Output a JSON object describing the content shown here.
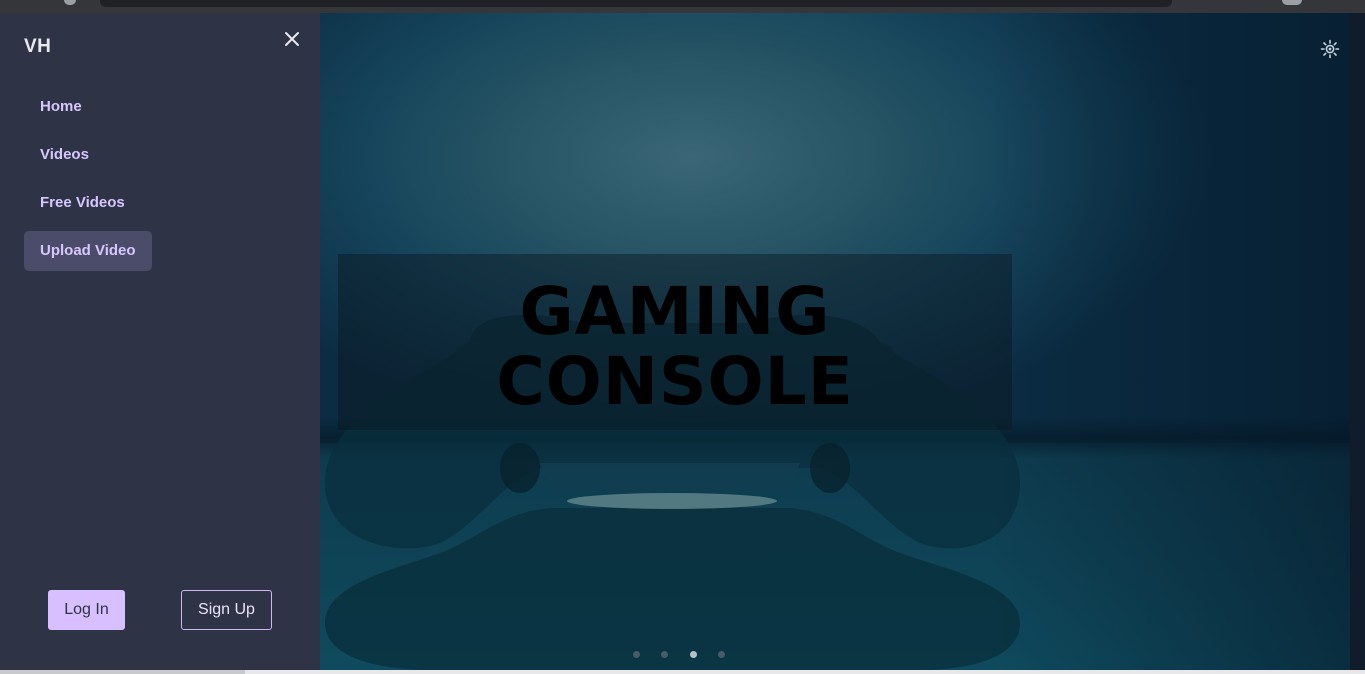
{
  "brand": "VH",
  "nav": {
    "items": [
      {
        "label": "Home"
      },
      {
        "label": "Videos"
      },
      {
        "label": "Free Videos"
      },
      {
        "label": "Upload Video"
      }
    ]
  },
  "auth": {
    "login_label": "Log In",
    "signup_label": "Sign Up"
  },
  "hero": {
    "caption_line1": "GAMING",
    "caption_line2": "CONSOLE",
    "slides_total": 4,
    "active_slide": 3
  },
  "icons": {
    "close": "close-icon",
    "theme": "sun-icon"
  },
  "colors": {
    "sidebar_bg": "#2e3346",
    "nav_text": "#d8c6ff",
    "active_nav_bg": "#4b4c69",
    "login_bg": "#d8bfff"
  }
}
